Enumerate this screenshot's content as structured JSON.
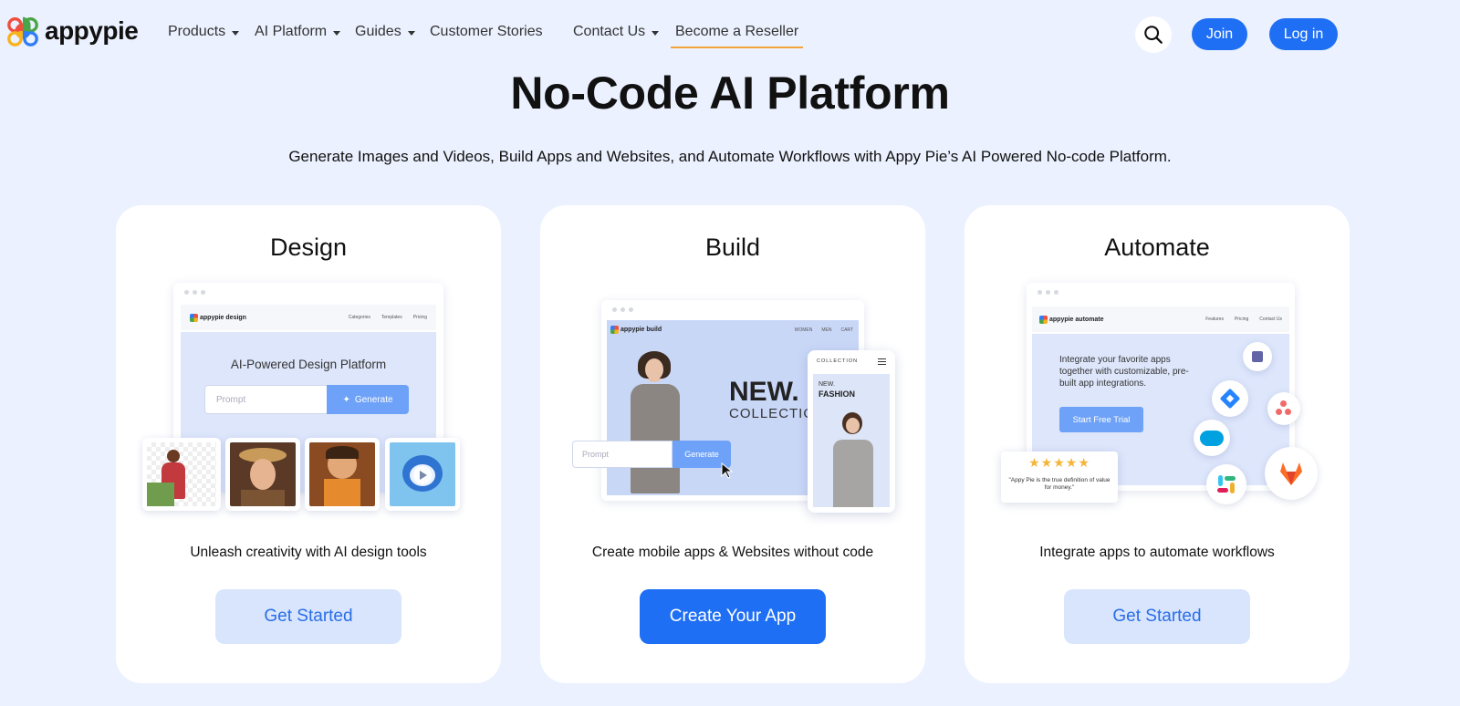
{
  "nav": {
    "logo_text": "appypie",
    "items": [
      {
        "label": "Products",
        "dropdown": true
      },
      {
        "label": "AI Platform",
        "dropdown": true
      },
      {
        "label": "Guides",
        "dropdown": true
      },
      {
        "label": "Customer Stories",
        "dropdown": false
      },
      {
        "label": "Contact Us",
        "dropdown": true
      },
      {
        "label": "Become a Reseller",
        "dropdown": false,
        "active": true
      }
    ],
    "join_label": "Join",
    "login_label": "Log in"
  },
  "hero": {
    "title": "No-Code AI Platform",
    "subtitle": "Generate Images and Videos, Build Apps and Websites, and Automate Workflows with Appy Pie’s AI Powered No-code Platform."
  },
  "cards": [
    {
      "title": "Design",
      "description": "Unleash creativity with AI design tools",
      "button": "Get Started",
      "mock": {
        "brand": "appypie design",
        "nav": [
          "Categories",
          "Templates",
          "Pricing"
        ],
        "headline": "AI-Powered Design Platform",
        "prompt_placeholder": "Prompt",
        "generate_label": "Generate"
      }
    },
    {
      "title": "Build",
      "description": "Create mobile apps & Websites without code",
      "button": "Create Your App",
      "mock": {
        "brand": "appypie build",
        "nav": [
          "WOMEN",
          "MEN",
          "CART"
        ],
        "headline_big": "NEW.",
        "headline_small": "COLLECTIO",
        "prompt_placeholder": "Prompt",
        "generate_label": "Generate",
        "phone_header": "COLLECTION",
        "phone_new": "NEW.",
        "phone_fashion": "FASHION"
      }
    },
    {
      "title": "Automate",
      "description": "Integrate apps to automate workflows",
      "button": "Get Started",
      "mock": {
        "brand": "appypie automate",
        "nav": [
          "Features",
          "Pricing",
          "Contact Us"
        ],
        "headline": "Integrate your favorite apps together with customizable, pre-built app integrations.",
        "cta": "Start Free Trial",
        "review_stars": "★★★★★",
        "review_text": "\"Appy Pie is the true definition of value for money.\"",
        "integration_icons": [
          "teams-icon",
          "jira-icon",
          "asana-icon",
          "salesforce-icon",
          "slack-icon",
          "gitlab-icon"
        ]
      }
    }
  ],
  "colors": {
    "background": "#ebf1fe",
    "primary": "#1f6ff5",
    "soft_button": "#d8e5fc",
    "reseller_underline": "#f3a43a"
  }
}
